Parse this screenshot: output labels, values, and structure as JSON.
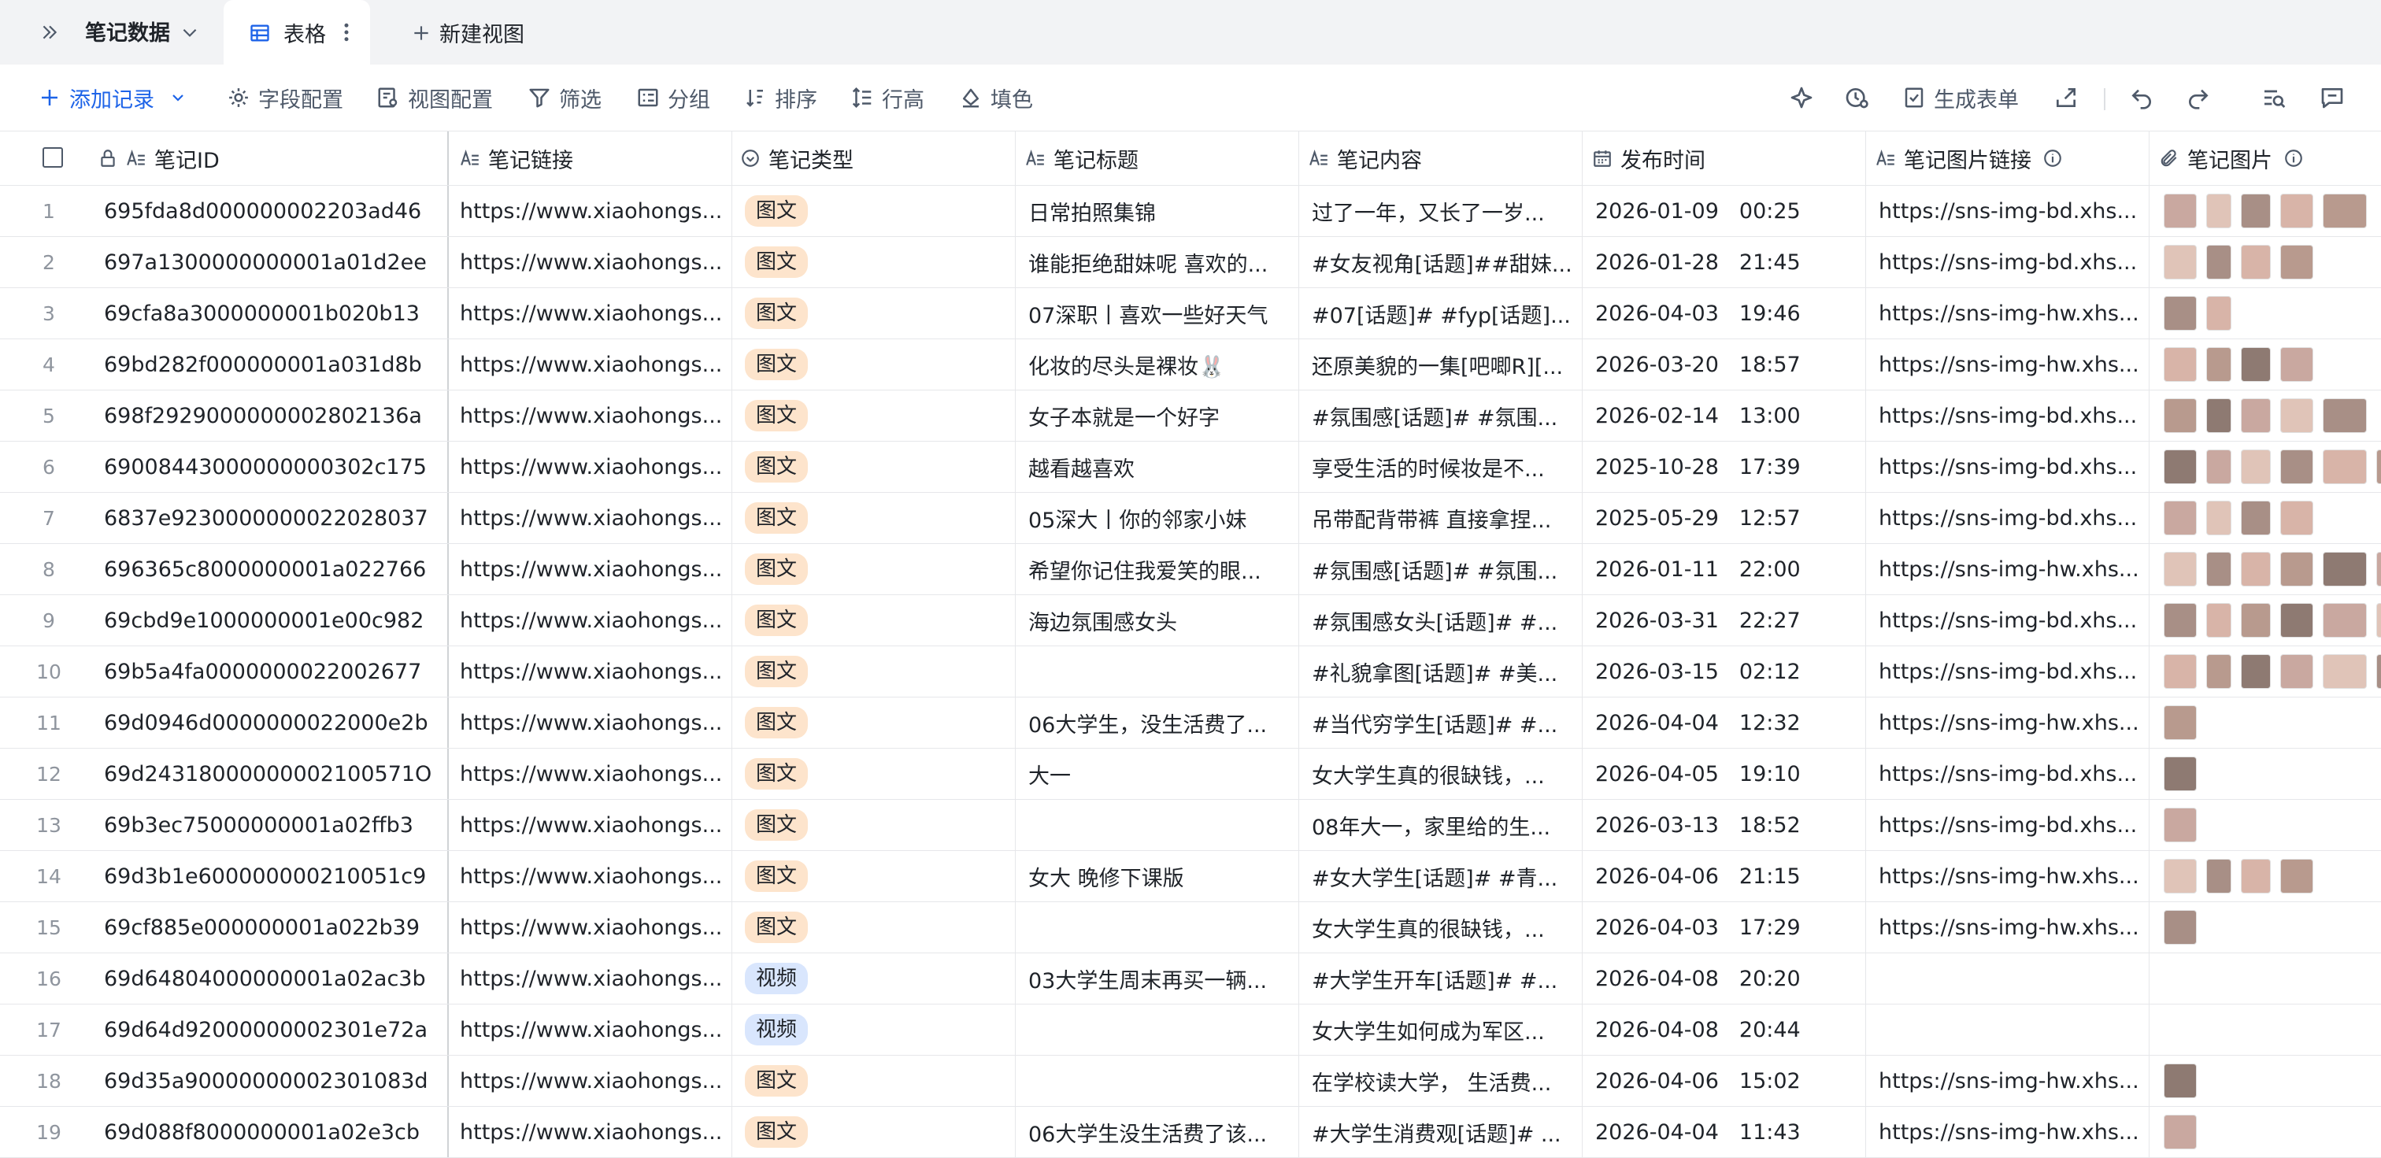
{
  "topbar": {
    "title": "笔记数据",
    "tab_label": "表格",
    "new_view": "新建视图"
  },
  "toolbar": {
    "add_record": "添加记录",
    "field_config": "字段配置",
    "view_config": "视图配置",
    "filter": "筛选",
    "group": "分组",
    "sort": "排序",
    "row_height": "行高",
    "fill_color": "填色",
    "generate_form": "生成表单"
  },
  "columns": {
    "note_id": "笔记ID",
    "note_link": "笔记链接",
    "note_type": "笔记类型",
    "note_title": "笔记标题",
    "note_content": "笔记内容",
    "publish_time": "发布时间",
    "image_link": "笔记图片链接",
    "images": "笔记图片"
  },
  "colors": {
    "accent": "#1d63e8",
    "tag_image": "#fde4cc",
    "tag_video": "#d9e6fd"
  },
  "rows": [
    {
      "n": "1",
      "id": "695fda8d000000002203ad46",
      "link": "https://www.xiaohongs...",
      "type": "图文",
      "title": "日常拍照集锦",
      "content": "过了一年，又长了一岁...",
      "date": "2026-01-09",
      "time": "00:25",
      "img_link": "https://sns-img-bd.xhs...",
      "thumbs": 5
    },
    {
      "n": "2",
      "id": "697a1300000000001a01d2ee",
      "link": "https://www.xiaohongs...",
      "type": "图文",
      "title": "谁能拒绝甜妹呢 喜欢的...",
      "content": "#女友视角[话题]##甜妹...",
      "date": "2026-01-28",
      "time": "21:45",
      "img_link": "https://sns-img-bd.xhs...",
      "thumbs": 4
    },
    {
      "n": "3",
      "id": "69cfa8a3000000001b020b13",
      "link": "https://www.xiaohongs...",
      "type": "图文",
      "title": "07深职丨喜欢一些好天气",
      "content": "#07[话题]# #fyp[话题]...",
      "date": "2026-04-03",
      "time": "19:46",
      "img_link": "https://sns-img-hw.xhs...",
      "thumbs": 2
    },
    {
      "n": "4",
      "id": "69bd282f000000001a031d8b",
      "link": "https://www.xiaohongs...",
      "type": "图文",
      "title": "化妆的尽头是裸妆🐰",
      "content": "还原美貌的一集[吧唧R][...",
      "date": "2026-03-20",
      "time": "18:57",
      "img_link": "https://sns-img-hw.xhs...",
      "thumbs": 4
    },
    {
      "n": "5",
      "id": "698f2929000000002802136a",
      "link": "https://www.xiaohongs...",
      "type": "图文",
      "title": "女子本就是一个好字",
      "content": "#氛围感[话题]# #氛围...",
      "date": "2026-02-14",
      "time": "13:00",
      "img_link": "https://sns-img-bd.xhs...",
      "thumbs": 5
    },
    {
      "n": "6",
      "id": "69008443000000000302c175",
      "link": "https://www.xiaohongs...",
      "type": "图文",
      "title": "越看越喜欢",
      "content": "享受生活的时候妆是不...",
      "date": "2025-10-28",
      "time": "17:39",
      "img_link": "https://sns-img-bd.xhs...",
      "thumbs": 6
    },
    {
      "n": "7",
      "id": "6837e9230000000022028037",
      "link": "https://www.xiaohongs...",
      "type": "图文",
      "title": "05深大丨你的邻家小妹",
      "content": "吊带配背带裤 直接拿捏...",
      "date": "2025-05-29",
      "time": "12:57",
      "img_link": "https://sns-img-bd.xhs...",
      "thumbs": 4
    },
    {
      "n": "8",
      "id": "696365c8000000001a022766",
      "link": "https://www.xiaohongs...",
      "type": "图文",
      "title": "希望你记住我爱笑的眼...",
      "content": "#氛围感[话题]# #氛围...",
      "date": "2026-01-11",
      "time": "22:00",
      "img_link": "https://sns-img-hw.xhs...",
      "thumbs": 6
    },
    {
      "n": "9",
      "id": "69cbd9e1000000001e00c982",
      "link": "https://www.xiaohongs...",
      "type": "图文",
      "title": "海边氛围感女头",
      "content": "#氛围感女头[话题]# #...",
      "date": "2026-03-31",
      "time": "22:27",
      "img_link": "https://sns-img-bd.xhs...",
      "thumbs": 6
    },
    {
      "n": "10",
      "id": "69b5a4fa0000000022002677",
      "link": "https://www.xiaohongs...",
      "type": "图文",
      "title": "",
      "content": "#礼貌拿图[话题]# #美...",
      "date": "2026-03-15",
      "time": "02:12",
      "img_link": "https://sns-img-bd.xhs...",
      "thumbs": 6
    },
    {
      "n": "11",
      "id": "69d0946d0000000022000e2b",
      "link": "https://www.xiaohongs...",
      "type": "图文",
      "title": "06大学生，没生活费了...",
      "content": "#当代穷学生[话题]# #...",
      "date": "2026-04-04",
      "time": "12:32",
      "img_link": "https://sns-img-hw.xhs...",
      "thumbs": 1
    },
    {
      "n": "12",
      "id": "69d24318000000002100571O",
      "link": "https://www.xiaohongs...",
      "type": "图文",
      "title": "大一",
      "content": "女大学生真的很缺钱，...",
      "date": "2026-04-05",
      "time": "19:10",
      "img_link": "https://sns-img-bd.xhs...",
      "thumbs": 1
    },
    {
      "n": "13",
      "id": "69b3ec75000000001a02ffb3",
      "link": "https://www.xiaohongs...",
      "type": "图文",
      "title": "",
      "content": "08年大一，家里给的生...",
      "date": "2026-03-13",
      "time": "18:52",
      "img_link": "https://sns-img-bd.xhs...",
      "thumbs": 1
    },
    {
      "n": "14",
      "id": "69d3b1e600000000210051c9",
      "link": "https://www.xiaohongs...",
      "type": "图文",
      "title": "女大 晚修下课版",
      "content": "#女大学生[话题]# #青...",
      "date": "2026-04-06",
      "time": "21:15",
      "img_link": "https://sns-img-hw.xhs...",
      "thumbs": 4
    },
    {
      "n": "15",
      "id": "69cf885e000000001a022b39",
      "link": "https://www.xiaohongs...",
      "type": "图文",
      "title": "",
      "content": "女大学生真的很缺钱，...",
      "date": "2026-04-03",
      "time": "17:29",
      "img_link": "https://sns-img-hw.xhs...",
      "thumbs": 1
    },
    {
      "n": "16",
      "id": "69d64804000000001a02ac3b",
      "link": "https://www.xiaohongs...",
      "type": "视频",
      "title": "03大学生周末再买一辆...",
      "content": "#大学生开车[话题]# #...",
      "date": "2026-04-08",
      "time": "20:20",
      "img_link": "",
      "thumbs": 0
    },
    {
      "n": "17",
      "id": "69d64d92000000002301e72a",
      "link": "https://www.xiaohongs...",
      "type": "视频",
      "title": "",
      "content": "女大学生如何成为军区...",
      "date": "2026-04-08",
      "time": "20:44",
      "img_link": "",
      "thumbs": 0
    },
    {
      "n": "18",
      "id": "69d35a90000000002301083d",
      "link": "https://www.xiaohongs...",
      "type": "图文",
      "title": "",
      "content": "在学校读大学， 生活费...",
      "date": "2026-04-06",
      "time": "15:02",
      "img_link": "https://sns-img-hw.xhs...",
      "thumbs": 1
    },
    {
      "n": "19",
      "id": "69d088f8000000001a02e3cb",
      "link": "https://www.xiaohongs...",
      "type": "图文",
      "title": "06大学生没生活费了该...",
      "content": "#大学生消费观[话题]# ...",
      "date": "2026-04-04",
      "time": "11:43",
      "img_link": "https://sns-img-hw.xhs...",
      "thumbs": 1
    }
  ]
}
